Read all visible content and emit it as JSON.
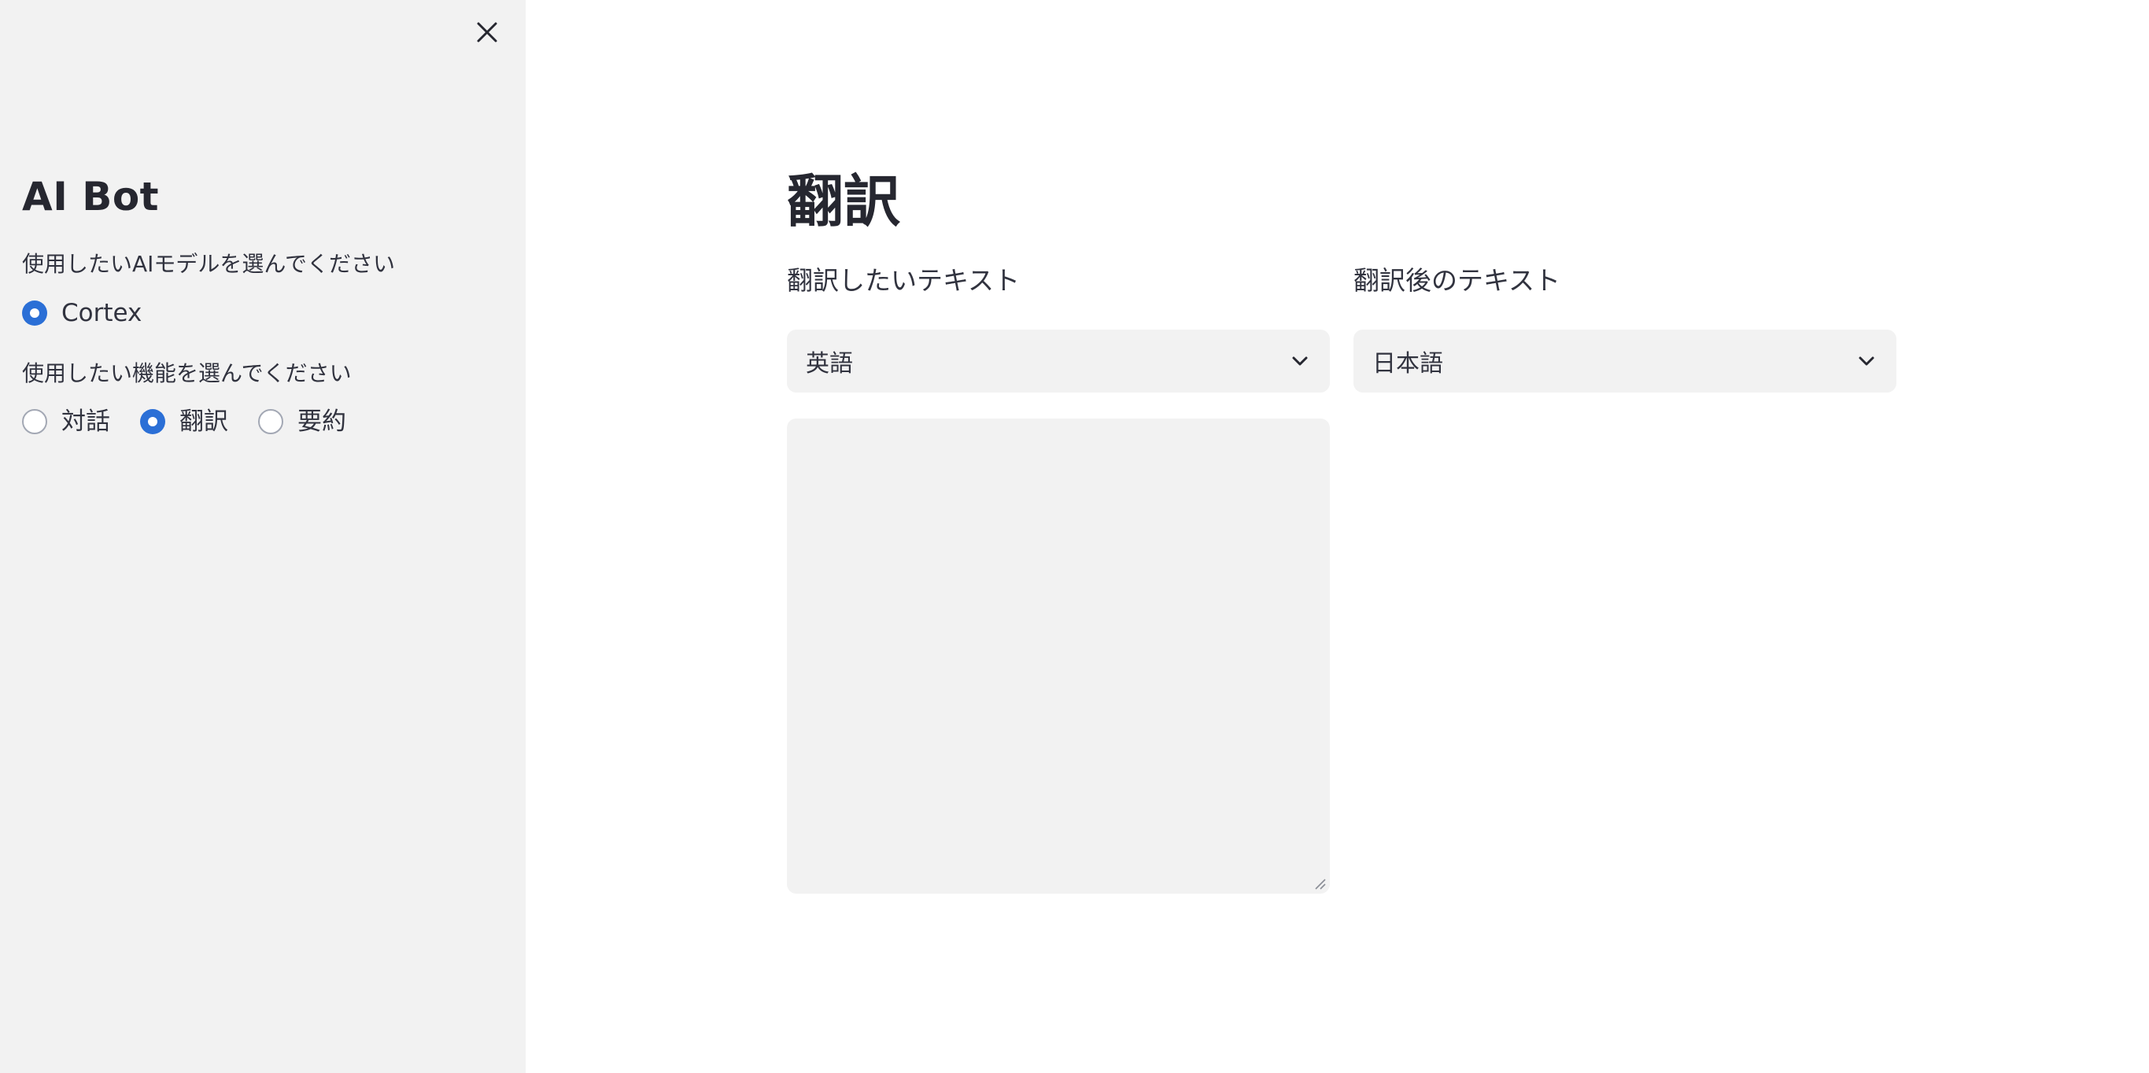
{
  "sidebar": {
    "title": "AI Bot",
    "model_prompt": "使用したいAIモデルを選んでください",
    "models": [
      {
        "label": "Cortex",
        "checked": true
      }
    ],
    "feature_prompt": "使用したい機能を選んでください",
    "features": [
      {
        "label": "対話",
        "checked": false
      },
      {
        "label": "翻訳",
        "checked": true
      },
      {
        "label": "要約",
        "checked": false
      }
    ],
    "close_icon": "close-icon"
  },
  "main": {
    "title": "翻訳",
    "source": {
      "label": "翻訳したいテキスト",
      "language": "英語",
      "text": ""
    },
    "target": {
      "label": "翻訳後のテキスト",
      "language": "日本語"
    }
  },
  "colors": {
    "sidebar_bg": "#f2f2f2",
    "radio_accent": "#2b6fd6",
    "input_bg": "#f2f2f2"
  }
}
